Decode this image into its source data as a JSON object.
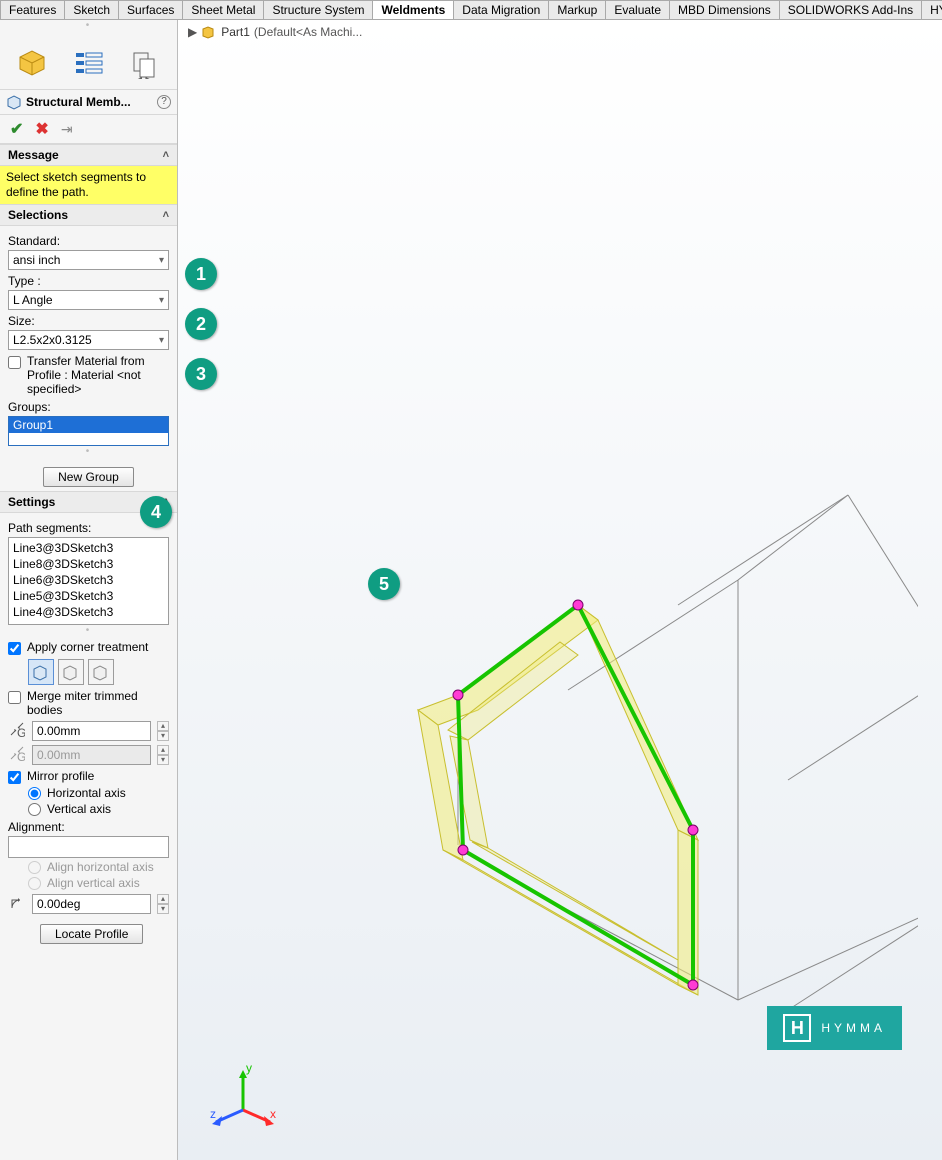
{
  "tabs": {
    "items": [
      "Features",
      "Sketch",
      "Surfaces",
      "Sheet Metal",
      "Structure System",
      "Weldments",
      "Data Migration",
      "Markup",
      "Evaluate",
      "MBD Dimensions",
      "SOLIDWORKS Add-Ins",
      "HYMMA"
    ],
    "active": "Weldments"
  },
  "breadcrumb": {
    "part": "Part1",
    "config": "(Default<As Machi..."
  },
  "feature": {
    "title": "Structural Memb...",
    "help_glyph": "?"
  },
  "sections": {
    "message": {
      "title": "Message",
      "text": "Select sketch segments to define the path."
    },
    "selections": {
      "title": "Selections",
      "standard_label": "Standard:",
      "standard_value": "ansi inch",
      "type_label": "Type :",
      "type_value": "L Angle",
      "size_label": "Size:",
      "size_value": "L2.5x2x0.3125",
      "transfer_label": "Transfer Material from Profile : Material <not specified>",
      "groups_label": "Groups:",
      "groups_selected": "Group1",
      "new_group": "New Group"
    },
    "settings": {
      "title": "Settings",
      "path_label": "Path segments:",
      "path_items": [
        "Line3@3DSketch3",
        "Line8@3DSketch3",
        "Line6@3DSketch3",
        "Line5@3DSketch3",
        "Line4@3DSketch3"
      ],
      "apply_corner": "Apply corner treatment",
      "merge_miter": "Merge miter trimmed bodies",
      "g1_value": "0.00mm",
      "g2_value": "0.00mm",
      "mirror_label": "Mirror profile",
      "horiz_label": "Horizontal axis",
      "vert_label": "Vertical axis",
      "alignment_label": "Alignment:",
      "align_h": "Align horizontal axis",
      "align_v": "Align vertical axis",
      "angle_value": "0.00deg",
      "locate_btn": "Locate Profile"
    }
  },
  "callouts": {
    "c1": "1",
    "c2": "2",
    "c3": "3",
    "c4": "4",
    "c5": "5"
  },
  "logo": {
    "letter": "H",
    "text": "HYMMA"
  }
}
